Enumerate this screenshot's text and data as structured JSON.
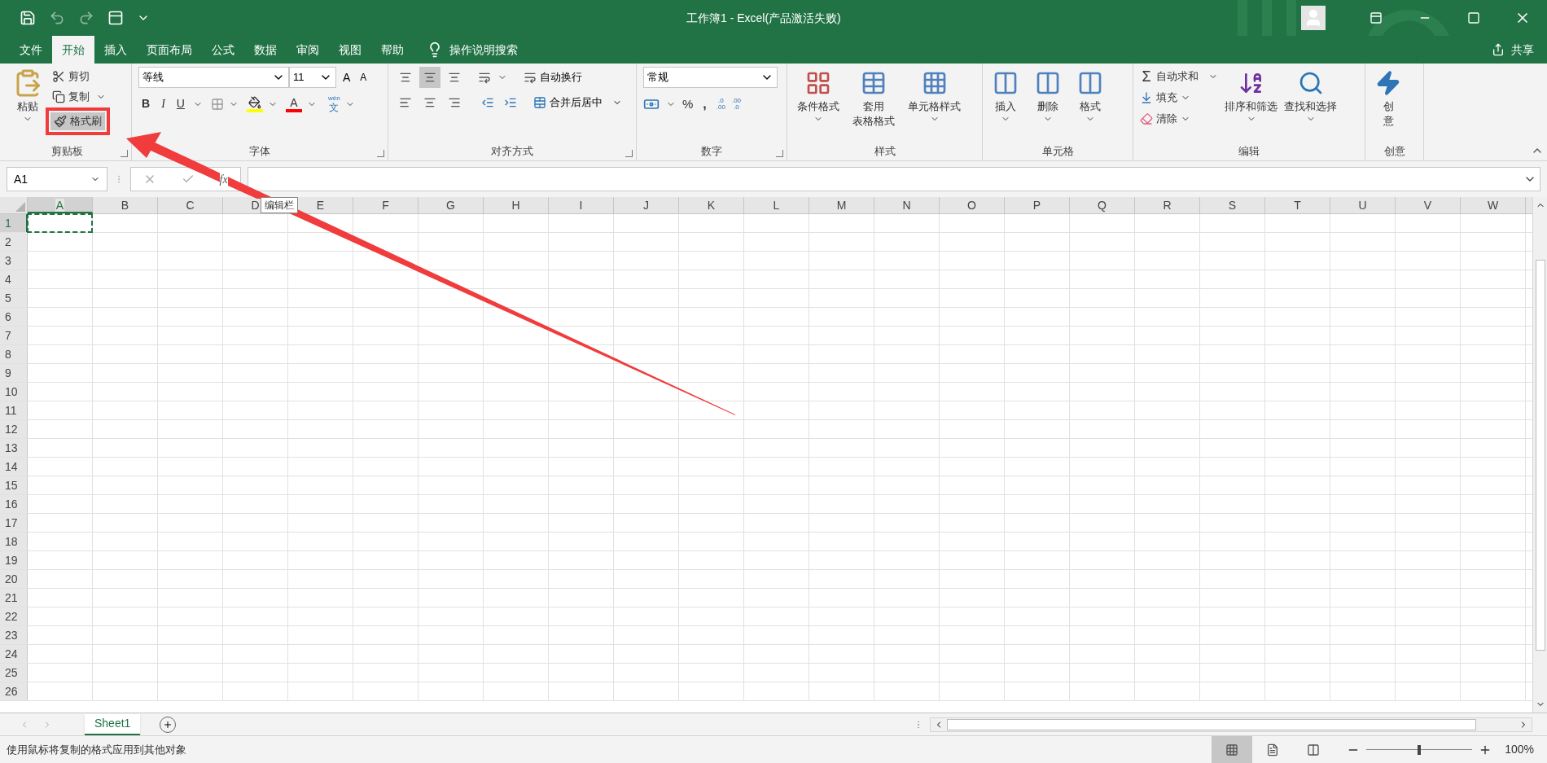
{
  "window": {
    "title": "工作簿1  -  Excel(产品激活失败)"
  },
  "tabs": [
    {
      "label": "文件",
      "selected": false
    },
    {
      "label": "开始",
      "selected": true
    },
    {
      "label": "插入",
      "selected": false
    },
    {
      "label": "页面布局",
      "selected": false
    },
    {
      "label": "公式",
      "selected": false
    },
    {
      "label": "数据",
      "selected": false
    },
    {
      "label": "审阅",
      "selected": false
    },
    {
      "label": "视图",
      "selected": false
    },
    {
      "label": "帮助",
      "selected": false
    }
  ],
  "tell_me": "操作说明搜索",
  "share": "共享",
  "clipboard": {
    "label": "剪贴板",
    "paste": "粘贴",
    "cut": "剪切",
    "copy": "复制",
    "format_painter": "格式刷"
  },
  "font": {
    "label": "字体",
    "font_name": "等线",
    "font_size": "11",
    "grow": "A",
    "shrink": "A",
    "bold": "B",
    "italic": "I",
    "underline": "U",
    "font_color": "A",
    "ruby": "wén",
    "phonetic": "文"
  },
  "alignment": {
    "label": "对齐方式",
    "vertical": [
      {
        "selected": false
      },
      {
        "selected": true
      },
      {
        "selected": false
      }
    ],
    "wrap_text": "自动换行",
    "merge_center": "合并后居中"
  },
  "number": {
    "label": "数字",
    "format": "常规",
    "percent": "%",
    "comma": ",",
    "increase_decimal": [
      ".0",
      ".00"
    ],
    "decrease_decimal": [
      ".00",
      ".0"
    ]
  },
  "styles": {
    "label": "样式",
    "conditional": "条件格式",
    "table": [
      "套用",
      "表格格式"
    ],
    "cell_styles": "单元格样式"
  },
  "cells": {
    "label": "单元格",
    "items": [
      "插入",
      "删除",
      "格式"
    ]
  },
  "editing": {
    "label": "编辑",
    "sigma": "Σ",
    "autosum": "自动求和",
    "fill": "填充",
    "clear": "清除",
    "sort": "排序和筛选",
    "find": "查找和选择"
  },
  "creative": {
    "label": "创意",
    "button": [
      "创",
      "意"
    ]
  },
  "formula_bar": {
    "name_box": "A1",
    "fx": "fx",
    "tooltip": "编辑栏"
  },
  "columns": [
    {
      "label": "A",
      "selected": true
    },
    {
      "label": "B",
      "selected": false
    },
    {
      "label": "C",
      "selected": false
    },
    {
      "label": "D",
      "selected": false
    },
    {
      "label": "E",
      "selected": false
    },
    {
      "label": "F",
      "selected": false
    },
    {
      "label": "G",
      "selected": false
    },
    {
      "label": "H",
      "selected": false
    },
    {
      "label": "I",
      "selected": false
    },
    {
      "label": "J",
      "selected": false
    },
    {
      "label": "K",
      "selected": false
    },
    {
      "label": "L",
      "selected": false
    },
    {
      "label": "M",
      "selected": false
    },
    {
      "label": "N",
      "selected": false
    },
    {
      "label": "O",
      "selected": false
    },
    {
      "label": "P",
      "selected": false
    },
    {
      "label": "Q",
      "selected": false
    },
    {
      "label": "R",
      "selected": false
    },
    {
      "label": "S",
      "selected": false
    },
    {
      "label": "T",
      "selected": false
    },
    {
      "label": "U",
      "selected": false
    },
    {
      "label": "V",
      "selected": false
    },
    {
      "label": "W",
      "selected": false
    }
  ],
  "rows": [
    {
      "label": "1",
      "selected": true
    },
    {
      "label": "2",
      "selected": false
    },
    {
      "label": "3",
      "selected": false
    },
    {
      "label": "4",
      "selected": false
    },
    {
      "label": "5",
      "selected": false
    },
    {
      "label": "6",
      "selected": false
    },
    {
      "label": "7",
      "selected": false
    },
    {
      "label": "8",
      "selected": false
    },
    {
      "label": "9",
      "selected": false
    },
    {
      "label": "10",
      "selected": false
    },
    {
      "label": "11",
      "selected": false
    },
    {
      "label": "12",
      "selected": false
    },
    {
      "label": "13",
      "selected": false
    },
    {
      "label": "14",
      "selected": false
    },
    {
      "label": "15",
      "selected": false
    },
    {
      "label": "16",
      "selected": false
    },
    {
      "label": "17",
      "selected": false
    },
    {
      "label": "18",
      "selected": false
    },
    {
      "label": "19",
      "selected": false
    },
    {
      "label": "20",
      "selected": false
    },
    {
      "label": "21",
      "selected": false
    },
    {
      "label": "22",
      "selected": false
    },
    {
      "label": "23",
      "selected": false
    },
    {
      "label": "24",
      "selected": false
    },
    {
      "label": "25",
      "selected": false
    },
    {
      "label": "26",
      "selected": false
    }
  ],
  "sheets": [
    {
      "label": "Sheet1",
      "selected": true
    }
  ],
  "status_bar": {
    "message": "使用鼠标将复制的格式应用到其他对象",
    "views": [
      {
        "selected": true
      },
      {
        "selected": false
      },
      {
        "selected": false
      }
    ],
    "zoom": {
      "level": 0.5,
      "reading": "100%"
    }
  }
}
